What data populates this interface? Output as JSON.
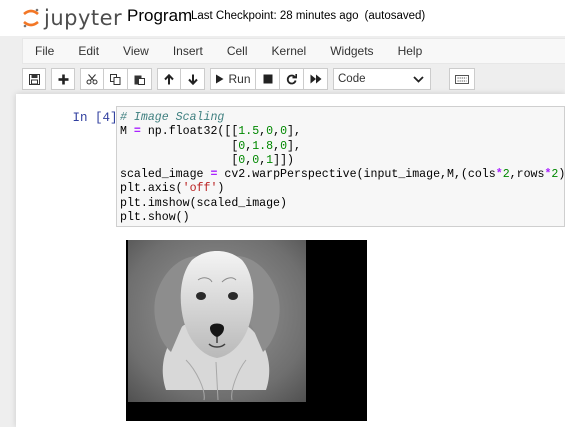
{
  "app": {
    "logo_text": "jupyter",
    "notebook_name": "Program",
    "checkpoint": "Last Checkpoint: 28 minutes ago",
    "autosave": "(autosaved)"
  },
  "menu": [
    "File",
    "Edit",
    "View",
    "Insert",
    "Cell",
    "Kernel",
    "Widgets",
    "Help"
  ],
  "toolbar": {
    "run_label": "Run",
    "cell_type": "Code",
    "icons": [
      "save-icon",
      "add-cell-icon",
      "cut-icon",
      "copy-icon",
      "paste-icon",
      "move-up-icon",
      "move-down-icon",
      "run-icon",
      "stop-icon",
      "restart-icon",
      "fast-forward-icon",
      "keyboard-icon"
    ]
  },
  "cell": {
    "prompt": "In [4]:",
    "code_lines": [
      [
        {
          "t": "comment",
          "s": "# Image Scaling"
        }
      ],
      [
        {
          "t": "text",
          "s": "M "
        },
        {
          "t": "op",
          "s": "="
        },
        {
          "t": "text",
          "s": " np.float32([["
        },
        {
          "t": "num",
          "s": "1.5"
        },
        {
          "t": "text",
          "s": ","
        },
        {
          "t": "num",
          "s": "0"
        },
        {
          "t": "text",
          "s": ","
        },
        {
          "t": "num",
          "s": "0"
        },
        {
          "t": "text",
          "s": "],"
        }
      ],
      [
        {
          "t": "text",
          "s": "                ["
        },
        {
          "t": "num",
          "s": "0"
        },
        {
          "t": "text",
          "s": ","
        },
        {
          "t": "num",
          "s": "1.8"
        },
        {
          "t": "text",
          "s": ","
        },
        {
          "t": "num",
          "s": "0"
        },
        {
          "t": "text",
          "s": "],"
        }
      ],
      [
        {
          "t": "text",
          "s": "                ["
        },
        {
          "t": "num",
          "s": "0"
        },
        {
          "t": "text",
          "s": ","
        },
        {
          "t": "num",
          "s": "0"
        },
        {
          "t": "text",
          "s": ","
        },
        {
          "t": "num",
          "s": "1"
        },
        {
          "t": "text",
          "s": "]])"
        }
      ],
      [
        {
          "t": "text",
          "s": "scaled_image "
        },
        {
          "t": "op",
          "s": "="
        },
        {
          "t": "text",
          "s": " cv2.warpPerspective(input_image,M,(cols"
        },
        {
          "t": "op",
          "s": "*"
        },
        {
          "t": "num",
          "s": "2"
        },
        {
          "t": "text",
          "s": ",rows"
        },
        {
          "t": "op",
          "s": "*"
        },
        {
          "t": "num",
          "s": "2"
        },
        {
          "t": "text",
          "s": "))"
        }
      ],
      [
        {
          "t": "text",
          "s": "plt.axis("
        },
        {
          "t": "str",
          "s": "'off'"
        },
        {
          "t": "text",
          "s": ")"
        }
      ],
      [
        {
          "t": "text",
          "s": "plt.imshow(scaled_image)"
        }
      ],
      [
        {
          "t": "text",
          "s": "plt.show()"
        }
      ]
    ]
  },
  "colors": {
    "logo_orange": "#f37726",
    "prompt_blue": "#303f9f",
    "comment": "#408080",
    "operator": "#aa22ff",
    "number": "#008800",
    "string": "#ba2121"
  }
}
